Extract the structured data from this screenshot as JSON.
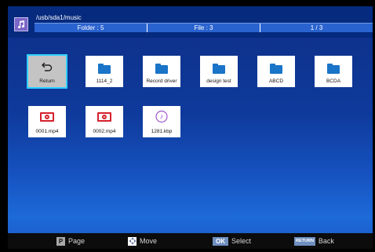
{
  "header": {
    "path": "/usb/sda1/music",
    "folder_count": "Folder : 5",
    "file_count": "File : 3",
    "page": "1 / 3"
  },
  "items": [
    {
      "label": "Return",
      "type": "return"
    },
    {
      "label": "1114_2",
      "type": "folder"
    },
    {
      "label": "Record driver",
      "type": "folder"
    },
    {
      "label": "design test",
      "type": "folder"
    },
    {
      "label": "ABCD",
      "type": "folder"
    },
    {
      "label": "BCDA",
      "type": "folder"
    },
    {
      "label": "0001.mp4",
      "type": "video"
    },
    {
      "label": "0002.mp4",
      "type": "video"
    },
    {
      "label": "1281.kbp",
      "type": "audio"
    }
  ],
  "footer": {
    "page_key": "P",
    "page_label": "Page",
    "move_label": "Move",
    "select_key": "OK",
    "select_label": "Select",
    "back_key": "RETURN",
    "back_label": "Back"
  },
  "colors": {
    "accent_selected": "#2fd0ff",
    "folder": "#1a74c8",
    "video": "#d6202c",
    "audio": "#8c36c8"
  }
}
